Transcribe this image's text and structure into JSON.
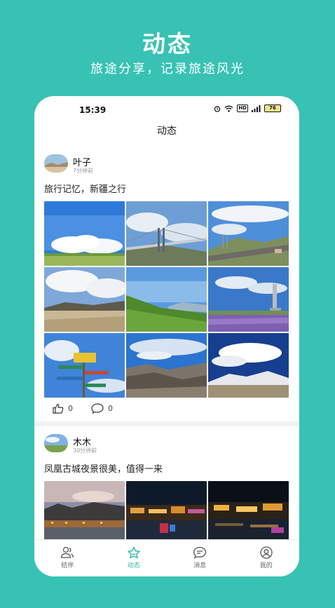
{
  "hero": {
    "title": "动态",
    "subtitle": "旅途分享，记录旅途风光"
  },
  "status_bar": {
    "time": "15:39",
    "network": "HD",
    "battery": "76",
    "icons": [
      "alarm-icon",
      "wifi-icon",
      "signal-icon",
      "battery-icon"
    ]
  },
  "nav": {
    "title": "动态"
  },
  "posts": [
    {
      "author": "叶子",
      "time_ago": "7分钟前",
      "text": "旅行记忆，新疆之行",
      "likes": "0",
      "comments": "0"
    },
    {
      "author": "木木",
      "time_ago": "30分钟前",
      "text": "凤凰古城夜景很美，值得一来"
    }
  ],
  "tabs": [
    {
      "label": "结伴",
      "icon": "companions-icon"
    },
    {
      "label": "动态",
      "icon": "moments-icon",
      "active": true
    },
    {
      "label": "消息",
      "icon": "message-icon"
    },
    {
      "label": "我的",
      "icon": "profile-icon"
    }
  ],
  "colors": {
    "brand": "#37c2b3",
    "tab_active": "#2bb7a7"
  }
}
